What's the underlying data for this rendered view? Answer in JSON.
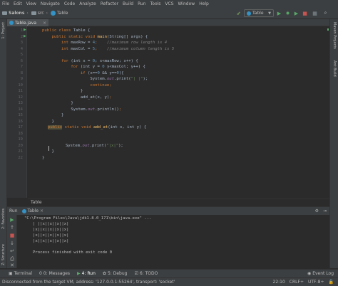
{
  "menu": [
    "File",
    "Edit",
    "View",
    "Navigate",
    "Code",
    "Analyze",
    "Refactor",
    "Build",
    "Run",
    "Tools",
    "VCS",
    "Window",
    "Help"
  ],
  "nav": {
    "crumbs": [
      "Salons",
      "src",
      "Table"
    ],
    "run_config": "Table"
  },
  "left_tool": "1: Project",
  "right_tools": [
    "Maven Projects",
    "Ant Build"
  ],
  "bottom_left_tools": [
    "2: Favorites",
    "Z: Structure"
  ],
  "editor": {
    "tab": "Table.java",
    "line_numbers": [
      "1",
      "2",
      "3",
      "4",
      "5",
      "6",
      "7",
      "8",
      "9",
      "10",
      "11",
      "12",
      "13",
      "14",
      "15",
      "16",
      "17",
      "18",
      "19",
      "20",
      "21",
      "22"
    ],
    "breadcrumb": "Table"
  },
  "code": {
    "l1_a": "public class ",
    "l1_b": "Table {",
    "l2_a": "    public static void ",
    "l2_b": "main",
    "l2_c": "(String[] args) {",
    "l3_a": "        int ",
    "l3_b": "maxRow = ",
    "l3_c": "4",
    "l3_d": ";    ",
    "l3_e": "//maximum row length is 4",
    "l4_a": "        int ",
    "l4_b": "maxCol = ",
    "l4_c": "5",
    "l4_d": ";    ",
    "l4_e": "//maximum column length is 5",
    "l6_a": "        for ",
    "l6_b": "(int ",
    "l6_c": "x = ",
    "l6_d": "0",
    "l6_e": "; x<maxRow; x++) {",
    "l7_a": "            for ",
    "l7_b": "(int ",
    "l7_c": "y = ",
    "l7_d": "0",
    "l7_e": " y<maxCol; y++) {",
    "l8_a": "                if ",
    "l8_b": "(x==",
    "l8_c": "0",
    "l8_d": " && y==",
    "l8_e": "0",
    "l8_f": "){",
    "l9_a": "                    System.",
    "l9_b": "out",
    "l9_c": ".print(",
    "l9_d": "\"| |\"",
    "l9_e": ");",
    "l10_a": "                    continue",
    "l10_b": ";",
    "l11": "                }",
    "l12_a": "                add_at(x, y)",
    "l12_b": ";",
    "l13": "            }",
    "l14_a": "            System.",
    "l14_b": "out",
    "l14_c": ".println()",
    "l14_d": ";",
    "l15": "        }",
    "l16": "    }",
    "l18_a": "public",
    "l18_b": " static void ",
    "l18_c": "add_at",
    "l18_d": "(int x, int y) {",
    "l20_a": "        System.",
    "l20_b": "out",
    "l20_c": ".print(",
    "l20_d": "\"|x|\"",
    "l20_e": ");",
    "l21": "    }",
    "l22": "}"
  },
  "run": {
    "tab_label": "Run",
    "config": "Table",
    "output": [
      "\"C:\\Program Files\\Java\\jdk1.8.0_171\\bin\\java.exe\" ...",
      "| ||x||x||x||x|",
      "|x||x||x||x||x|",
      "|x||x||x||x||x|",
      "|x||x||x||x||x|",
      "",
      "Process finished with exit code 0"
    ]
  },
  "bottom_tabs": [
    {
      "icon": "▣",
      "label": "Terminal"
    },
    {
      "icon": "0",
      "label": "0: Messages"
    },
    {
      "icon": "▶",
      "label": "4: Run"
    },
    {
      "icon": "✿",
      "label": "5: Debug"
    },
    {
      "icon": "☑",
      "label": "6: TODO"
    }
  ],
  "event_log": "Event Log",
  "status": {
    "message": "Disconnected from the target VM, address: '127.0.0.1:55264', transport: 'socket'",
    "position": "22:10",
    "line_sep": "CRLF÷",
    "encoding": "UTF-8÷"
  },
  "colors": {
    "keyword": "#cc7832",
    "number": "#6897bb",
    "comment": "#808080",
    "method": "#ffc66d",
    "string": "#6a8759",
    "static_field": "#9876aa"
  }
}
